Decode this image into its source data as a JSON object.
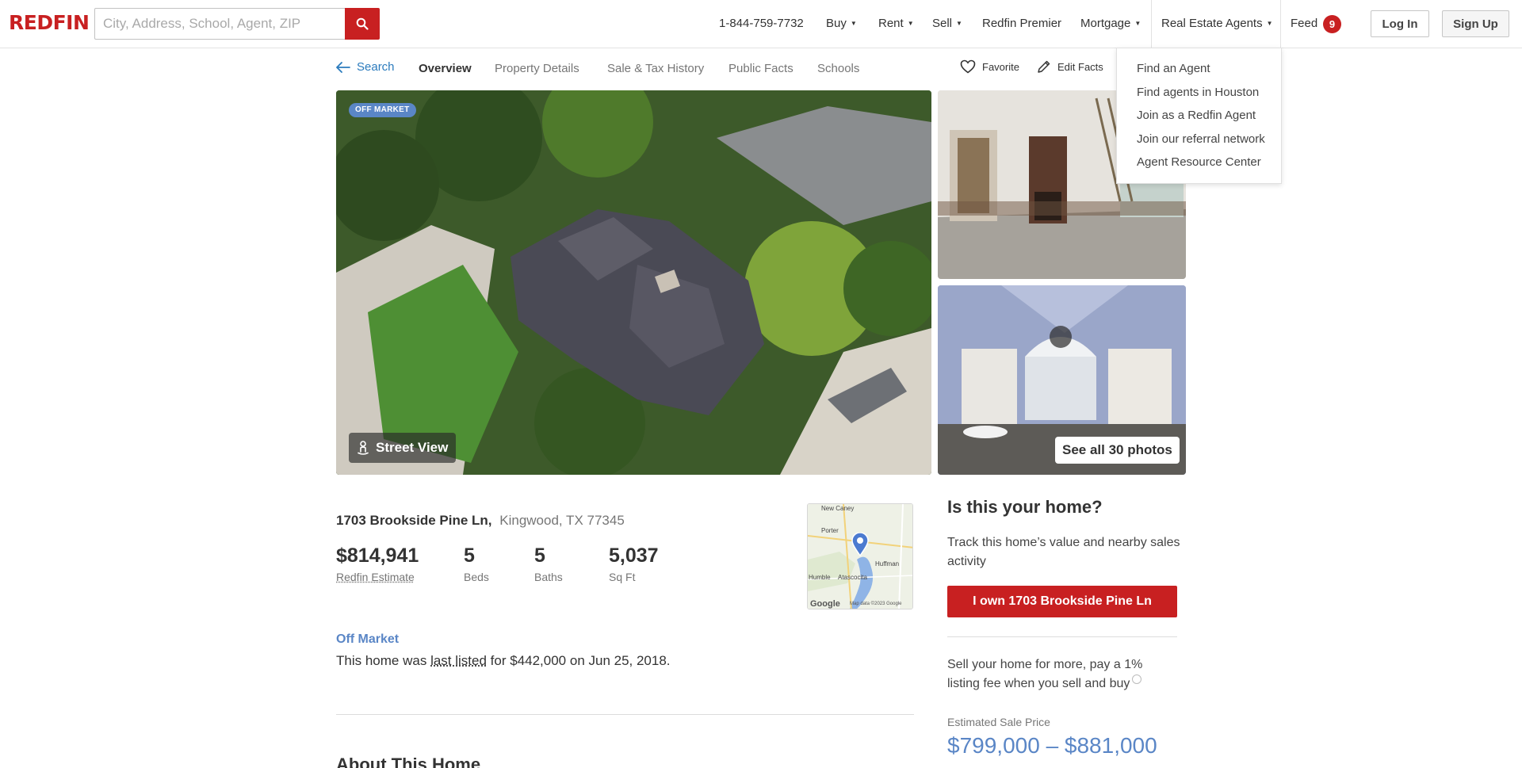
{
  "header": {
    "logo": "REDFIN",
    "search_placeholder": "City, Address, School, Agent, ZIP",
    "phone": "1-844-759-7732",
    "nav": {
      "buy": "Buy",
      "rent": "Rent",
      "sell": "Sell",
      "premier": "Redfin Premier",
      "mortgage": "Mortgage",
      "agents": "Real Estate Agents",
      "feed": "Feed",
      "feed_count": "9"
    },
    "login": "Log In",
    "signup": "Sign Up",
    "brand_color": "#c82021"
  },
  "agents_menu": {
    "items": [
      "Find an Agent",
      "Find agents in Houston",
      "Join as a Redfin Agent",
      "Join our referral network",
      "Agent Resource Center"
    ]
  },
  "subnav": {
    "search": "Search",
    "overview": "Overview",
    "details": "Property Details",
    "history": "Sale & Tax History",
    "facts": "Public Facts",
    "schools": "Schools",
    "favorite": "Favorite",
    "edit": "Edit Facts"
  },
  "photos": {
    "badge": "OFF MARKET",
    "street_view": "Street View",
    "see_all": "See all 30 photos"
  },
  "property": {
    "street": "1703 Brookside Pine Ln,",
    "city": "Kingwood, TX 77345",
    "price": "$814,941",
    "price_label": "Redfin Estimate",
    "beds": "5",
    "beds_label": "Beds",
    "baths": "5",
    "baths_label": "Baths",
    "sqft": "5,037",
    "sqft_label": "Sq Ft",
    "status": "Off Market",
    "listed_prefix": "This home was",
    "listed_link": "last listed",
    "listed_suffix": "for $442,000 on Jun 25, 2018.",
    "about_title": "About This Home"
  },
  "map": {
    "labels": [
      "New Caney",
      "Porter",
      "Huffman",
      "Humble",
      "Atascocita"
    ],
    "google": "Google",
    "attribution": "Map data ©2023 Google"
  },
  "panel": {
    "title": "Is this your home?",
    "text": "Track this home’s value and nearby sales activity",
    "own_button": "I own 1703 Brookside Pine Ln",
    "sell_text": "Sell your home for more, pay a 1% listing fee when you sell and buy",
    "est_label": "Estimated Sale Price",
    "est_range": "$799,000 – $881,000",
    "accent_color": "#5a86c6"
  }
}
